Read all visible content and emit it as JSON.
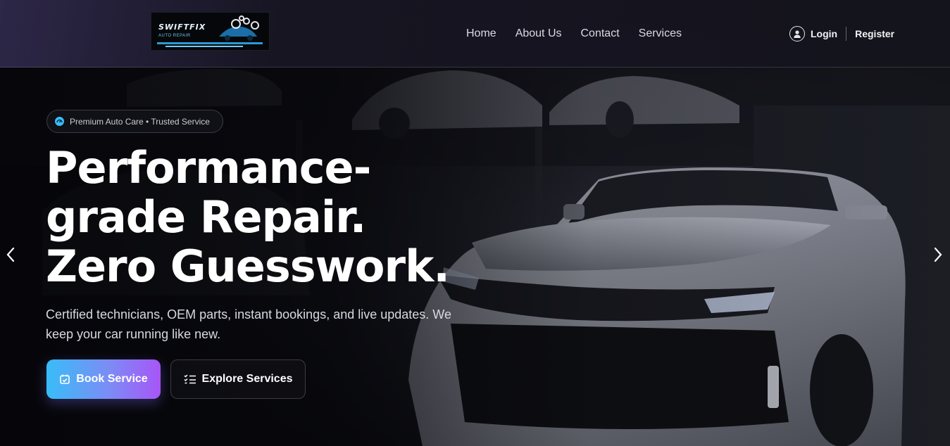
{
  "header": {
    "logo": {
      "title": "SWIFTFIX",
      "subtitle": "AUTO REPAIR",
      "gear_icon": "gears-icon"
    },
    "nav": [
      {
        "label": "Home"
      },
      {
        "label": "About Us"
      },
      {
        "label": "Contact"
      },
      {
        "label": "Services"
      }
    ],
    "auth": {
      "login_label": "Login",
      "register_label": "Register",
      "user_icon": "user-circle-icon"
    }
  },
  "hero": {
    "badge_text": "Premium Auto Care • Trusted Service",
    "badge_icon": "gauge-icon",
    "headline": "Performance-grade Repair. Zero Guesswork.",
    "subtext": "Certified technicians, OEM parts, instant bookings, and live updates. We keep your car running like new.",
    "primary_button": {
      "label": "Book Service",
      "icon": "calendar-check-icon"
    },
    "secondary_button": {
      "label": "Explore Services",
      "icon": "list-check-icon"
    },
    "carousel": {
      "prev_icon": "chevron-left-icon",
      "next_icon": "chevron-right-icon"
    }
  },
  "colors": {
    "accent_start": "#38bdf8",
    "accent_end": "#a855f7",
    "background": "#07080d"
  }
}
